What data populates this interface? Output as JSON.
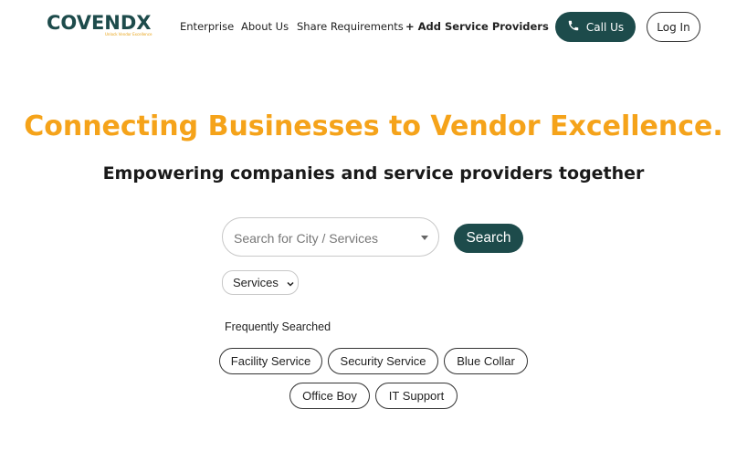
{
  "header": {
    "logo_text": "COVENDX",
    "logo_tagline": "Unlock Vendor Excellence",
    "nav": {
      "enterprise": "Enterprise",
      "about": "About Us",
      "share": "Share Requirements",
      "add_providers": "+ Add Service Providers"
    },
    "call_label": "Call Us",
    "login_label": "Log In"
  },
  "hero": {
    "title": "Connecting Businesses to Vendor Excellence.",
    "subtitle": "Empowering companies and service providers together"
  },
  "search": {
    "placeholder": "Search for City / Services",
    "button_label": "Search",
    "category_selected": "Services"
  },
  "frequently_searched": {
    "label": "Frequently Searched",
    "chips": [
      "Facility Service",
      "Security Service",
      "Blue Collar",
      "Office Boy",
      "IT Support"
    ]
  },
  "colors": {
    "brand_teal": "#1d4b4b",
    "accent_orange": "#f5a31a"
  },
  "icons": {
    "call": "phone-icon",
    "dropdown": "caret-down-icon",
    "select": "chevron-down-icon"
  }
}
